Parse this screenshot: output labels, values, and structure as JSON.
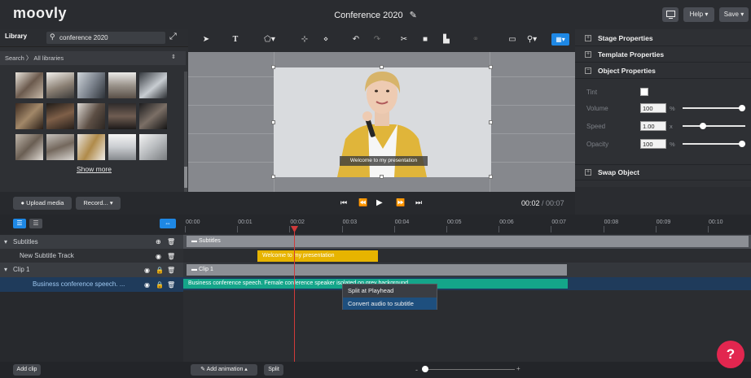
{
  "app": {
    "logo": "moovly",
    "title": "Conference 2020"
  },
  "topbar": {
    "help_label": "Help ▾",
    "save_label": "Save ▾"
  },
  "library": {
    "tab_label": "Library",
    "search_value": "conference 2020",
    "filter_label": "Search  〉 All libraries",
    "show_more": "Show more",
    "upload_label": "Upload media",
    "record_label": "Record... ▾"
  },
  "stage": {
    "caption": "Welcome to my presentation",
    "timecode_current": "00:02",
    "timecode_total": "/ 00:07"
  },
  "panel": {
    "stage_properties": "Stage Properties",
    "template_properties": "Template Properties",
    "object_properties": "Object Properties",
    "swap_object": "Swap Object",
    "tint_label": "Tint",
    "volume_label": "Volume",
    "volume_value": "100",
    "volume_unit": "%",
    "speed_label": "Speed",
    "speed_value": "1.00",
    "speed_unit": "x",
    "opacity_label": "Opacity",
    "opacity_value": "100",
    "opacity_unit": "%",
    "volume_level": 1.0,
    "speed_level": 0.3,
    "opacity_level": 1.0
  },
  "timeline": {
    "ticks": [
      "00:00",
      "00:01",
      "00:02",
      "00:03",
      "00:04",
      "00:05",
      "00:06",
      "00:07",
      "00:08",
      "00:09",
      "00:10"
    ],
    "tracks": [
      {
        "label": "Subtitles"
      },
      {
        "label": "New Subtitle Track"
      },
      {
        "label": "Clip 1"
      },
      {
        "label": "Business conference speech. ..."
      }
    ],
    "clips": {
      "subtitles": "Subtitles",
      "welcome": "Welcome to my presentation",
      "clip1": "Clip 1",
      "business": "Business conference speech. Female conference speaker isolated on grey background."
    },
    "context_menu": [
      "Split at Playhead",
      "Convert audio to subtitle"
    ]
  },
  "bottom": {
    "add_clip": "Add clip",
    "add_animation": "Add animation ▴",
    "split": "Split",
    "help_label": "?"
  },
  "colors": {
    "accent": "#1e88e5",
    "subtitle_clip": "#e7b400",
    "audio_clip": "#14a58a",
    "help": "#e2264f"
  }
}
